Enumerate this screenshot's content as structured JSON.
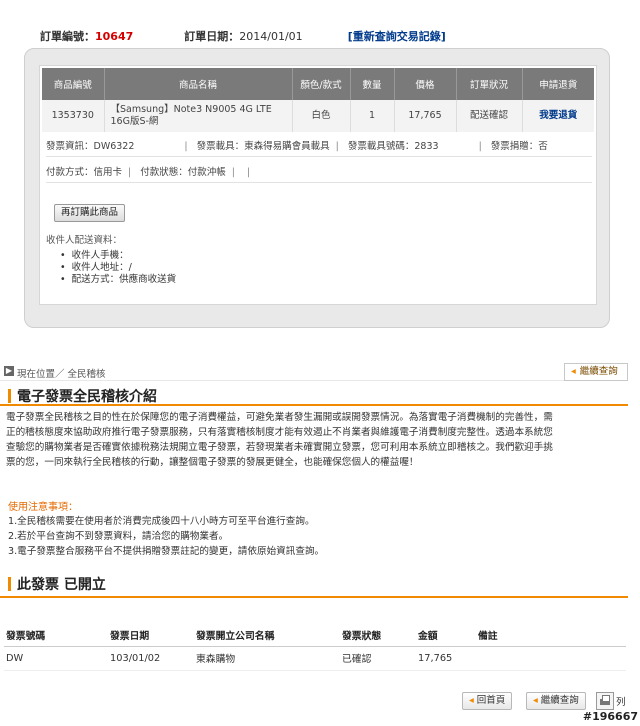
{
  "order_header": {
    "order_no_label": "訂單編號：",
    "order_no": "10647",
    "order_date_label": "訂單日期：",
    "order_date": "2014/01/01",
    "requery_link": "[重新查詢交易記錄]"
  },
  "items_table": {
    "headers": [
      "商品編號",
      "商品名稱",
      "顏色/款式",
      "數量",
      "價格",
      "訂單狀況",
      "申請退貨"
    ],
    "row": {
      "product_no": "1353730",
      "product_name_line1": "【Samsung】Note3 N9005 4G LTE",
      "product_name_line2": "16G版S-網",
      "color": "白色",
      "qty": "1",
      "price": "17,765",
      "status": "配送確認",
      "refund": "我要退貨"
    }
  },
  "invoice_info": {
    "invoice_label": "發票資訊：DW6322",
    "carrier_label": "發票載具：東森得易購會員載具",
    "carrier_no_label": "發票載具號碼：2833",
    "donate_label": "發票捐贈：否"
  },
  "payment_info": {
    "method": "付款方式：信用卡",
    "status": "付款狀態：付款沖帳"
  },
  "rebuy_button": "再訂購此商品",
  "receiver": {
    "title": "收件人配送資料：",
    "items": [
      "收件人手機：",
      "收件人地址：/",
      "配送方式：供應商收送貨"
    ]
  },
  "breadcrumb": {
    "text": "現在位置／ 全民稽核",
    "right_button": "繼續查詢"
  },
  "section1": {
    "title": "電子發票全民稽核介紹",
    "intro_lines": [
      "電子發票全民稽核之目的性在於保障您的電子消費權益，可避免業者發生漏開或誤開發票情況。為落實電子消費機制的完善性，需",
      "正的稽核態度來協助政府推行電子發票服務，只有落實稽核制度才能有效遏止不肖業者與維護電子消費制度完整性。透過本系統您",
      "查驗您的購物業者是否確實依據稅務法規開立電子發票，若發現業者未確實開立發票，您可利用本系統立即稽核之。我們歡迎手挑",
      "票的您，一同來執行全民稽核的行動，讓整個電子發票的發展更健全，也能確保您個人的權益喔！"
    ],
    "notice_title": "使用注意事項：",
    "notices": [
      "1.全民稽核需要在使用者於消費完成後四十八小時方可至平台進行查詢。",
      "2.若於平台查詢不到發票資料，請洽您的購物業者。",
      "3.電子發票整合服務平台不提供捐贈發票註記的變更，請依原始資訊查詢。"
    ]
  },
  "section2": {
    "title": "此發票 已開立",
    "headers": [
      "發票號碼",
      "發票日期",
      "發票開立公司名稱",
      "發票狀態",
      "金額",
      "備註"
    ],
    "row": [
      "DW",
      "103/01/02",
      "東森購物",
      "已確認",
      "17,765",
      ""
    ]
  },
  "footer": {
    "back_button": "回首頁",
    "continue_button": "繼續查詢",
    "print_label": "列"
  },
  "watermark": "#196667",
  "colors": {
    "accent": "#f08a00",
    "header_gray": "#7a7a7a",
    "order_red": "#d40000",
    "link_blue": "#003a8c"
  }
}
